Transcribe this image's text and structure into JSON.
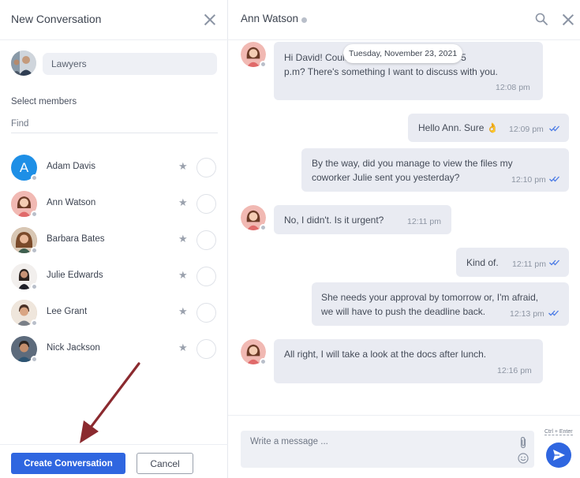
{
  "new_conversation": {
    "title": "New Conversation",
    "group_name": "Lawyers",
    "select_members_label": "Select members",
    "find_placeholder": "Find",
    "members": [
      {
        "name": "Adam Davis",
        "initial": "A",
        "avatar_color": "#1e8fe6"
      },
      {
        "name": "Ann Watson",
        "avatar_color": "#f1b9b3"
      },
      {
        "name": "Barbara Bates",
        "avatar_color": "#b98b6b"
      },
      {
        "name": "Julie Edwards",
        "avatar_color": "#e9e4e1"
      },
      {
        "name": "Lee Grant",
        "avatar_color": "#d9c2aa"
      },
      {
        "name": "Nick Jackson",
        "avatar_color": "#6f7d8f"
      }
    ],
    "create_label": "Create Conversation",
    "cancel_label": "Cancel"
  },
  "chat": {
    "contact_name": "Ann Watson",
    "date_separator": "Tuesday, November 23, 2021",
    "messages": [
      {
        "from": "contact",
        "line1": "Hi David! Could you call me today around 5",
        "line2": "p.m? There's something I want to discuss with you.",
        "time": "12:08 pm"
      },
      {
        "from": "me",
        "text": "Hello Ann. Sure 👌",
        "time": "12:09 pm"
      },
      {
        "from": "me",
        "line1": "By the way, did you manage to view the files my",
        "line2": "coworker Julie sent you yesterday?",
        "time": "12:10 pm"
      },
      {
        "from": "contact",
        "text": "No, I didn't. Is it urgent?",
        "time": "12:11 pm"
      },
      {
        "from": "me",
        "text": "Kind of.",
        "time": "12:11 pm"
      },
      {
        "from": "me",
        "line1": "She needs your approval by tomorrow or, I'm afraid,",
        "line2": "we will have to push the deadline back.",
        "time": "12:13 pm"
      },
      {
        "from": "contact",
        "text": "All right, I will take a look at the docs after lunch.",
        "time": "12:16 pm"
      }
    ],
    "input_placeholder": "Write a message ...",
    "shortcut_hint": "Ctrl + Enter"
  },
  "colors": {
    "accent": "#2f66e0",
    "bubble": "#e9ebf2",
    "read_ticks": "#4b7be5",
    "annotation_arrow": "#8b2a2f"
  },
  "icons": [
    "close-icon",
    "search-icon",
    "star-icon",
    "paperclip-icon",
    "smile-icon",
    "send-icon",
    "double-check-icon"
  ]
}
